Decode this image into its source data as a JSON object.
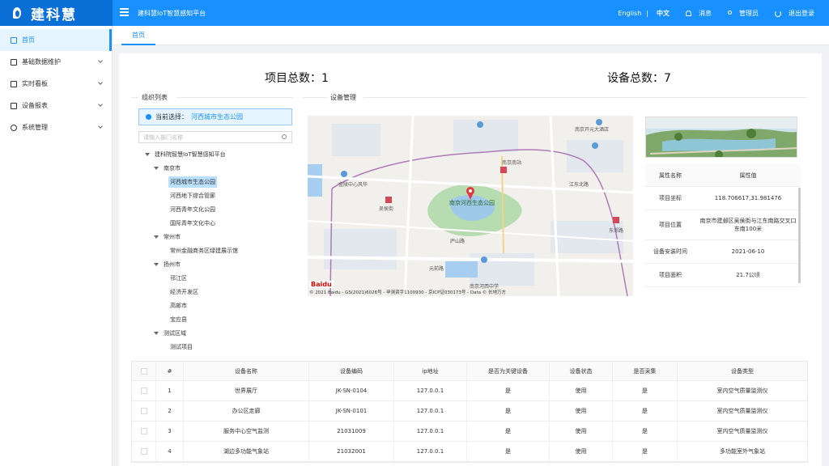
{
  "app": {
    "logo_text": "建科慧",
    "platform_name": "建科慧IoT智慧感知平台"
  },
  "header": {
    "lang_en": "English",
    "lang_sep": "|",
    "lang_zh": "中文",
    "messages": "消息",
    "user": "管理员",
    "logout": "退出登录"
  },
  "sidebar": {
    "items": [
      {
        "label": "首页",
        "icon": "home-icon"
      },
      {
        "label": "基础数据维护",
        "icon": "edit-icon"
      },
      {
        "label": "实时看板",
        "icon": "board-icon"
      },
      {
        "label": "设备报表",
        "icon": "report-icon"
      },
      {
        "label": "系统管理",
        "icon": "gear-icon"
      }
    ]
  },
  "tabs": {
    "home": "首页"
  },
  "stats": {
    "projects_label": "项目总数：1",
    "devices_label": "设备总数：7"
  },
  "org": {
    "title": "组织列表",
    "selected_prefix": "当前选择：",
    "selected_value": "河西城市生态公园",
    "search_placeholder": "请输入部门名称",
    "tree": {
      "root": "建科院智慧IoT智慧感知平台",
      "nanjing": "南京市",
      "nj1": "河西城市生态公园",
      "nj2": "河西地下综合管廊",
      "nj3": "河西青年文化公园",
      "nj4": "国际青年文化中心",
      "changzhou": "常州市",
      "cz1": "常州金融商务区绿建展示馆",
      "yangzhou": "扬州市",
      "yz1": "邗江区",
      "yz2": "经济开发区",
      "yz3": "高邮市",
      "yz4": "宝应县",
      "test": "测试区域",
      "t1": "测试项目"
    }
  },
  "device_mgmt": {
    "title": "设备管理"
  },
  "map": {
    "labels": {
      "l1": "南京南站",
      "l2": "南京河西生态公园",
      "l3": "庐山路",
      "l4": "吴侯街",
      "l5": "金陵中心风华",
      "l6": "南京开元大酒店",
      "l7": "东郊路",
      "l8": "江东北路",
      "l9": "元前路",
      "l10": "南京河西中学"
    },
    "copyright": "© 2021 Baidu - GS(2021)6026号 - 甲测资字1100930 - 京ICP证030173号 - Data © 长地万方",
    "brand": "Baidu"
  },
  "props": {
    "header_key": "属性名称",
    "header_val": "属性值",
    "rows": [
      {
        "k": "项目坐标",
        "v": "118.706617,31.981476"
      },
      {
        "k": "项目位置",
        "v": "南京市建邺区吴侯街与江东南路交叉口东南100米"
      },
      {
        "k": "设备安装时间",
        "v": "2021-06-10"
      },
      {
        "k": "项目面积",
        "v": "21.7公顷"
      }
    ]
  },
  "devices": {
    "headers": [
      "#",
      "设备名称",
      "设备编码",
      "ip地址",
      "是否为关键设备",
      "设备状态",
      "是否采集",
      "设备类型"
    ],
    "rows": [
      [
        "1",
        "世界展厅",
        "JK-SN-0104",
        "127.0.0.1",
        "是",
        "使用",
        "是",
        "室内空气质量监测仪"
      ],
      [
        "2",
        "办公区走廊",
        "JK-SN-0101",
        "127.0.0.1",
        "是",
        "使用",
        "是",
        "室内空气质量监测仪"
      ],
      [
        "3",
        "服务中心空气监测",
        "21031009",
        "127.0.0.1",
        "是",
        "使用",
        "是",
        "室内空气质量监测仪"
      ],
      [
        "4",
        "湖边多功能气象站",
        "21032001",
        "127.0.0.1",
        "是",
        "使用",
        "是",
        "多功能室外气象站"
      ]
    ]
  },
  "colors": {
    "primary": "#1890ff",
    "sidebar_active": "#e6f4ff"
  }
}
